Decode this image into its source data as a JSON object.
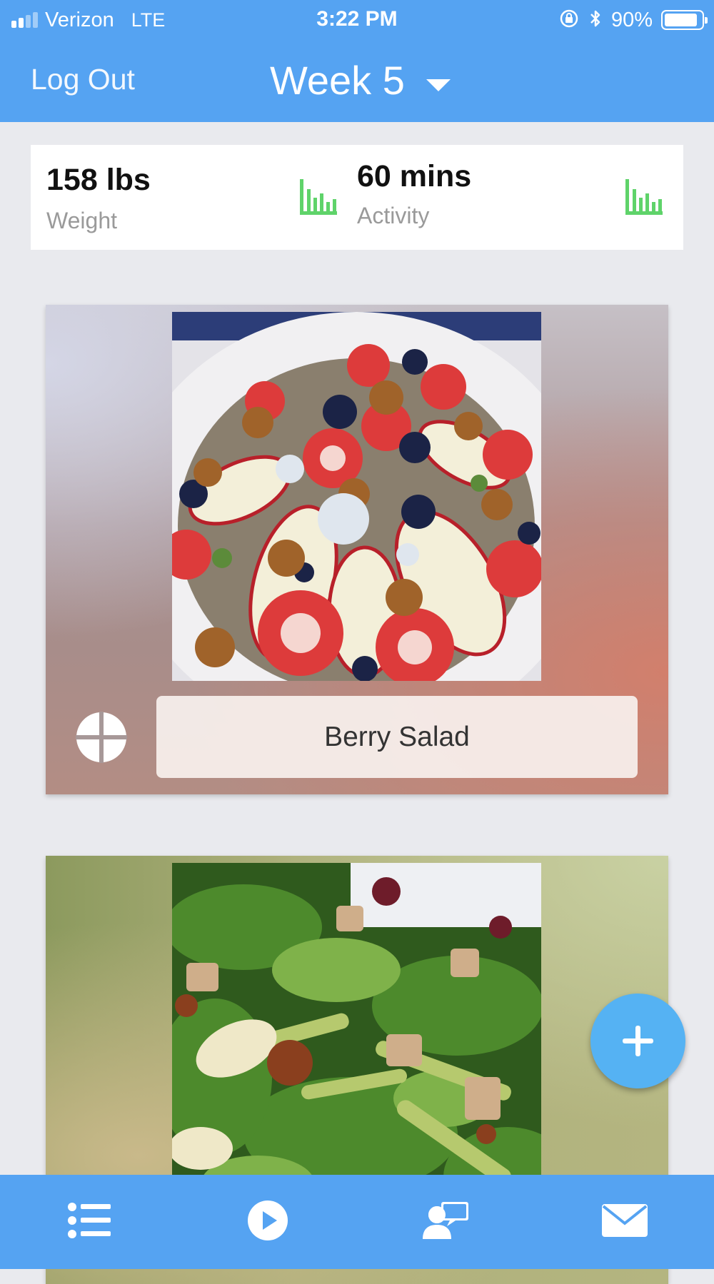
{
  "status_bar": {
    "carrier": "Verizon",
    "network": "LTE",
    "time": "3:22 PM",
    "battery_percent": "90%",
    "battery_level": 0.9,
    "signal_bars": 2,
    "icons": [
      "signal-icon",
      "rotation-lock-icon",
      "bluetooth-icon",
      "battery-icon"
    ]
  },
  "header": {
    "logout_label": "Log Out",
    "week_title": "Week 5"
  },
  "stats": {
    "weight": {
      "value": "158 lbs",
      "label": "Weight",
      "icon": "bar-chart-icon"
    },
    "activity": {
      "value": "60 mins",
      "label": "Activity",
      "icon": "bar-chart-icon"
    }
  },
  "meals": [
    {
      "name": "Berry Salad",
      "photo": "berry salad with strawberries, blueberries, apple slices, walnuts and blue cheese",
      "share_icon": "share-icon"
    },
    {
      "photo": "green salad with celery, chicken, pear and walnuts"
    }
  ],
  "fab": {
    "icon": "plus-icon"
  },
  "tab_bar": {
    "items": [
      {
        "icon": "list-icon"
      },
      {
        "icon": "play-icon"
      },
      {
        "icon": "coach-chat-icon"
      },
      {
        "icon": "mail-icon"
      }
    ]
  },
  "colors": {
    "header_blue": "#55a3f2",
    "chart_icon_green": "#5fd36a",
    "fab_blue": "#55b2f3",
    "background": "#e9eaee"
  }
}
